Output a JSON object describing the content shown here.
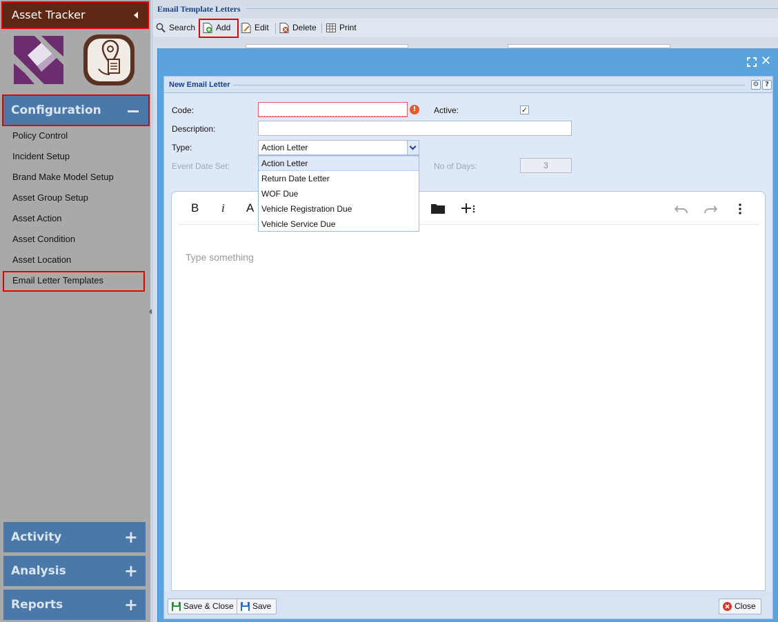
{
  "sidebar": {
    "app_title": "Asset Tracker",
    "sections": {
      "configuration": "Configuration",
      "activity": "Activity",
      "analysis": "Analysis",
      "reports": "Reports"
    },
    "menu_items": [
      "Policy Control",
      "Incident Setup",
      "Brand Make Model Setup",
      "Asset Group Setup",
      "Asset Action",
      "Asset Condition",
      "Asset Location",
      "Email Letter Templates"
    ]
  },
  "main": {
    "title": "Email Template Letters",
    "toolbar": {
      "search": "Search",
      "add": "Add",
      "edit": "Edit",
      "delete": "Delete",
      "print": "Print"
    }
  },
  "modal": {
    "panel_title": "New Email Letter",
    "form": {
      "code_label": "Code:",
      "code_value": "",
      "active_label": "Active:",
      "active_checked": true,
      "description_label": "Description:",
      "description_value": "",
      "type_label": "Type:",
      "type_value": "Action Letter",
      "event_date_label": "Event Date Set:",
      "days_label": "No of Days:",
      "days_value": "3"
    },
    "type_options": [
      "Action Letter",
      "Return Date Letter",
      "WOF Due",
      "Vehicle Registration Due",
      "Vehicle Service Due"
    ],
    "editor": {
      "bold": "B",
      "italic": "i",
      "font_size": "A",
      "placeholder": "Type something"
    },
    "footer": {
      "save_close": "Save & Close",
      "save": "Save",
      "close": "Close"
    }
  },
  "colors": {
    "app_header": "#5e2714",
    "accordion": "#4a78a8",
    "highlight": "#e00000",
    "modal": "#5aa3dd",
    "panel": "#dfe8f6"
  }
}
